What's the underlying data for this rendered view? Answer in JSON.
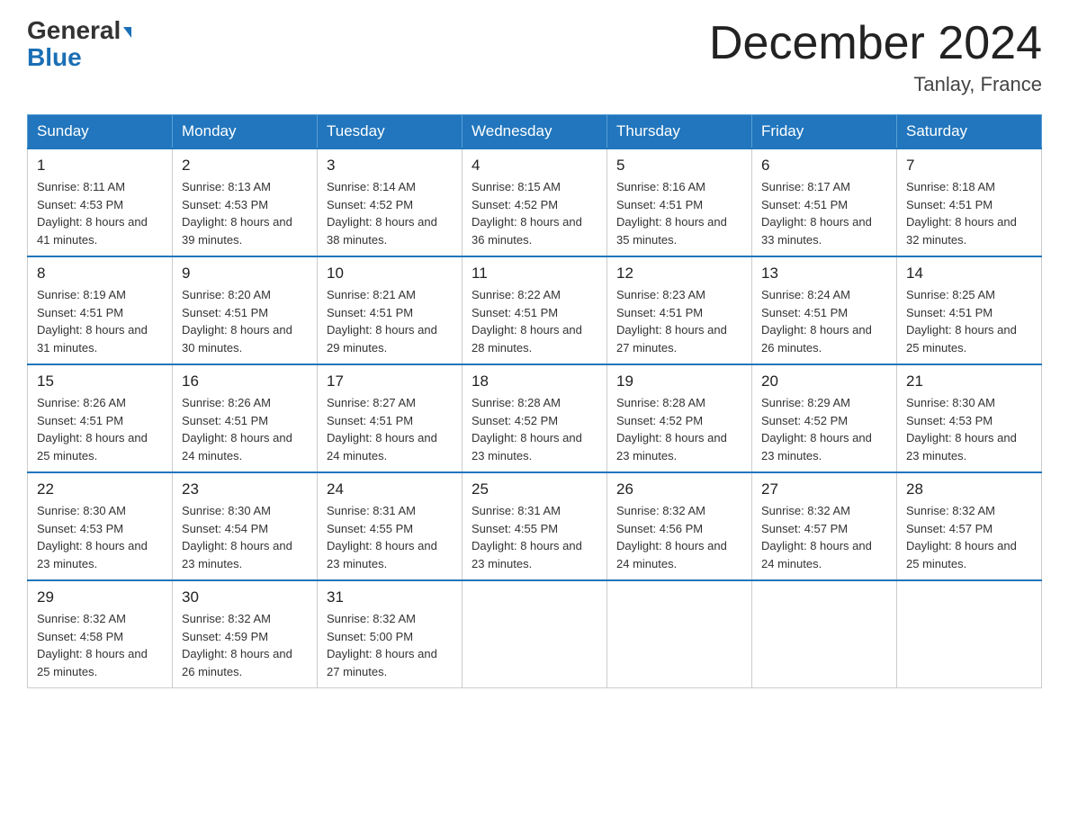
{
  "header": {
    "logo_line1": "General",
    "logo_line2": "Blue",
    "month_title": "December 2024",
    "location": "Tanlay, France"
  },
  "days_of_week": [
    "Sunday",
    "Monday",
    "Tuesday",
    "Wednesday",
    "Thursday",
    "Friday",
    "Saturday"
  ],
  "weeks": [
    [
      {
        "day": "1",
        "sunrise": "8:11 AM",
        "sunset": "4:53 PM",
        "daylight": "8 hours and 41 minutes."
      },
      {
        "day": "2",
        "sunrise": "8:13 AM",
        "sunset": "4:53 PM",
        "daylight": "8 hours and 39 minutes."
      },
      {
        "day": "3",
        "sunrise": "8:14 AM",
        "sunset": "4:52 PM",
        "daylight": "8 hours and 38 minutes."
      },
      {
        "day": "4",
        "sunrise": "8:15 AM",
        "sunset": "4:52 PM",
        "daylight": "8 hours and 36 minutes."
      },
      {
        "day": "5",
        "sunrise": "8:16 AM",
        "sunset": "4:51 PM",
        "daylight": "8 hours and 35 minutes."
      },
      {
        "day": "6",
        "sunrise": "8:17 AM",
        "sunset": "4:51 PM",
        "daylight": "8 hours and 33 minutes."
      },
      {
        "day": "7",
        "sunrise": "8:18 AM",
        "sunset": "4:51 PM",
        "daylight": "8 hours and 32 minutes."
      }
    ],
    [
      {
        "day": "8",
        "sunrise": "8:19 AM",
        "sunset": "4:51 PM",
        "daylight": "8 hours and 31 minutes."
      },
      {
        "day": "9",
        "sunrise": "8:20 AM",
        "sunset": "4:51 PM",
        "daylight": "8 hours and 30 minutes."
      },
      {
        "day": "10",
        "sunrise": "8:21 AM",
        "sunset": "4:51 PM",
        "daylight": "8 hours and 29 minutes."
      },
      {
        "day": "11",
        "sunrise": "8:22 AM",
        "sunset": "4:51 PM",
        "daylight": "8 hours and 28 minutes."
      },
      {
        "day": "12",
        "sunrise": "8:23 AM",
        "sunset": "4:51 PM",
        "daylight": "8 hours and 27 minutes."
      },
      {
        "day": "13",
        "sunrise": "8:24 AM",
        "sunset": "4:51 PM",
        "daylight": "8 hours and 26 minutes."
      },
      {
        "day": "14",
        "sunrise": "8:25 AM",
        "sunset": "4:51 PM",
        "daylight": "8 hours and 25 minutes."
      }
    ],
    [
      {
        "day": "15",
        "sunrise": "8:26 AM",
        "sunset": "4:51 PM",
        "daylight": "8 hours and 25 minutes."
      },
      {
        "day": "16",
        "sunrise": "8:26 AM",
        "sunset": "4:51 PM",
        "daylight": "8 hours and 24 minutes."
      },
      {
        "day": "17",
        "sunrise": "8:27 AM",
        "sunset": "4:51 PM",
        "daylight": "8 hours and 24 minutes."
      },
      {
        "day": "18",
        "sunrise": "8:28 AM",
        "sunset": "4:52 PM",
        "daylight": "8 hours and 23 minutes."
      },
      {
        "day": "19",
        "sunrise": "8:28 AM",
        "sunset": "4:52 PM",
        "daylight": "8 hours and 23 minutes."
      },
      {
        "day": "20",
        "sunrise": "8:29 AM",
        "sunset": "4:52 PM",
        "daylight": "8 hours and 23 minutes."
      },
      {
        "day": "21",
        "sunrise": "8:30 AM",
        "sunset": "4:53 PM",
        "daylight": "8 hours and 23 minutes."
      }
    ],
    [
      {
        "day": "22",
        "sunrise": "8:30 AM",
        "sunset": "4:53 PM",
        "daylight": "8 hours and 23 minutes."
      },
      {
        "day": "23",
        "sunrise": "8:30 AM",
        "sunset": "4:54 PM",
        "daylight": "8 hours and 23 minutes."
      },
      {
        "day": "24",
        "sunrise": "8:31 AM",
        "sunset": "4:55 PM",
        "daylight": "8 hours and 23 minutes."
      },
      {
        "day": "25",
        "sunrise": "8:31 AM",
        "sunset": "4:55 PM",
        "daylight": "8 hours and 23 minutes."
      },
      {
        "day": "26",
        "sunrise": "8:32 AM",
        "sunset": "4:56 PM",
        "daylight": "8 hours and 24 minutes."
      },
      {
        "day": "27",
        "sunrise": "8:32 AM",
        "sunset": "4:57 PM",
        "daylight": "8 hours and 24 minutes."
      },
      {
        "day": "28",
        "sunrise": "8:32 AM",
        "sunset": "4:57 PM",
        "daylight": "8 hours and 25 minutes."
      }
    ],
    [
      {
        "day": "29",
        "sunrise": "8:32 AM",
        "sunset": "4:58 PM",
        "daylight": "8 hours and 25 minutes."
      },
      {
        "day": "30",
        "sunrise": "8:32 AM",
        "sunset": "4:59 PM",
        "daylight": "8 hours and 26 minutes."
      },
      {
        "day": "31",
        "sunrise": "8:32 AM",
        "sunset": "5:00 PM",
        "daylight": "8 hours and 27 minutes."
      },
      null,
      null,
      null,
      null
    ]
  ]
}
